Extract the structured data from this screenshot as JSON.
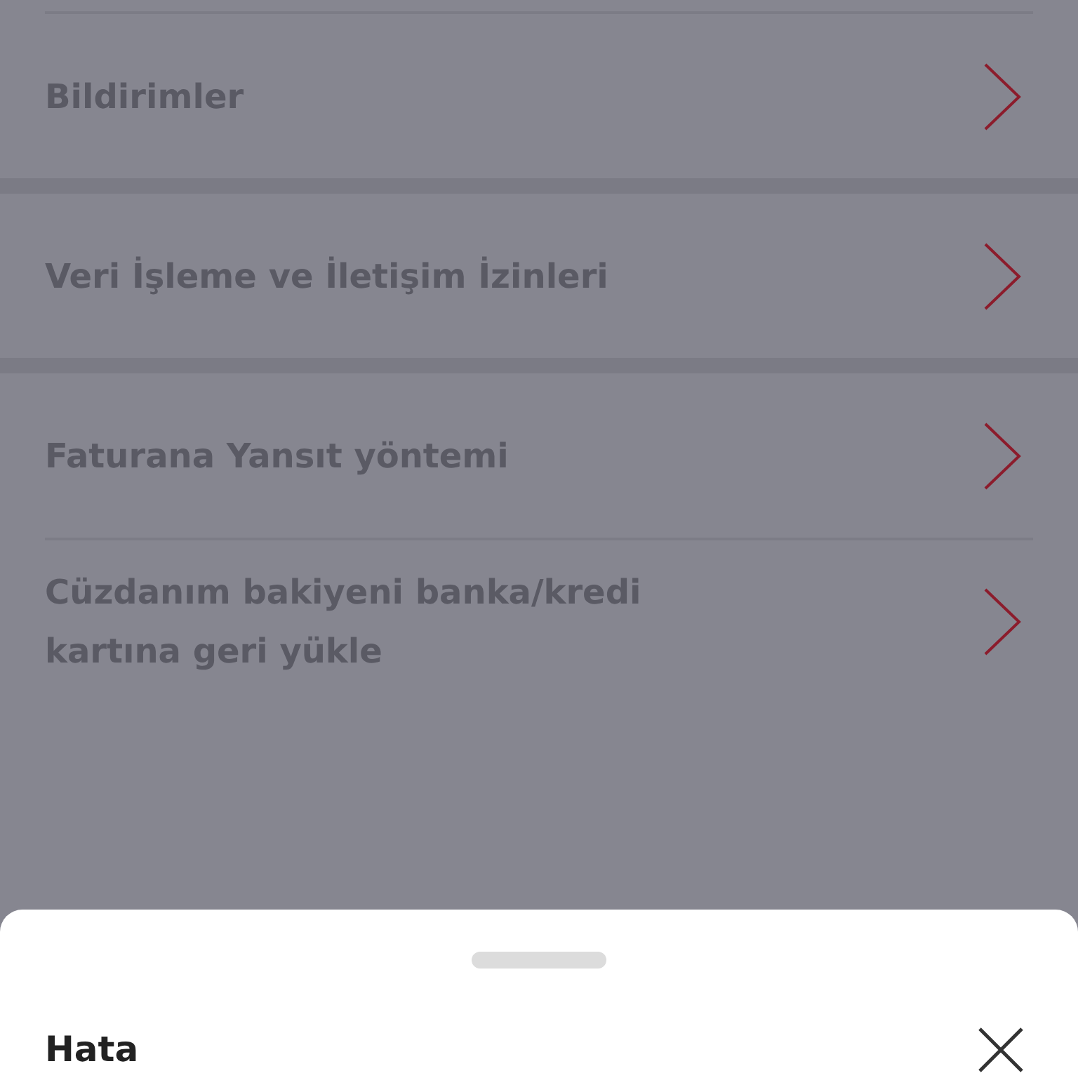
{
  "sections": [
    {
      "items": [
        {
          "label": "Bildirimler"
        }
      ]
    },
    {
      "items": [
        {
          "label": "Veri İşleme ve İletişim İzinleri"
        }
      ]
    },
    {
      "items": [
        {
          "label": "Faturana Yansıt yöntemi"
        },
        {
          "label": "Cüzdanım bakiyeni banka/kredi kartına geri yükle"
        }
      ]
    }
  ],
  "sheet": {
    "title": "Hata"
  }
}
